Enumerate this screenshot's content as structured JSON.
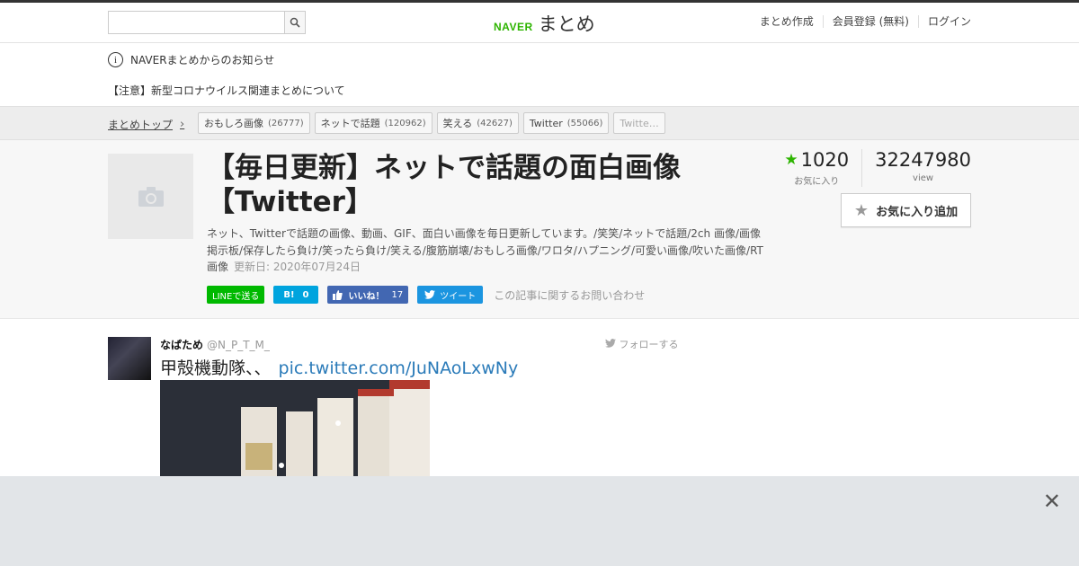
{
  "header": {
    "search_placeholder": "",
    "logo_naver": "NAVER",
    "logo_matome": "まとめ",
    "nav": [
      "まとめ作成",
      "会員登録 (無料)",
      "ログイン"
    ]
  },
  "notice": {
    "title": "NAVERまとめからのお知らせ",
    "link": "【注意】新型コロナウイルス関連まとめについて"
  },
  "breadcrumb": {
    "top": "まとめトップ",
    "tags": [
      {
        "label": "おもしろ画像",
        "count": "(26777)"
      },
      {
        "label": "ネットで話題",
        "count": "(120962)"
      },
      {
        "label": "笑える",
        "count": "(42627)"
      },
      {
        "label": "Twitter",
        "count": "(55066)"
      },
      {
        "label": "Twitte…",
        "count": ""
      }
    ]
  },
  "article": {
    "title_line1": "【毎日更新】ネットで話題の面白画像",
    "title_line2": "【Twitter】",
    "description": "ネット、Twitterで話題の画像、動画、GIF、面白い画像を毎日更新しています。/笑笑/ネットで話題/2ch 画像/画像掲示板/保存したら負け/笑ったら負け/笑える/腹筋崩壊/おもしろ画像/ワロタ/ハプニング/可愛い画像/吹いた画像/RT画像",
    "updated": "更新日: 2020年07月24日",
    "favorites_count": "1020",
    "favorites_label": "お気に入り",
    "views_count": "32247980",
    "views_label": "view",
    "fav_button": "お気に入り追加",
    "share": {
      "line": "LINEで送る",
      "hatena_icon": "B!",
      "hatena_count": "0",
      "fb_label": "いいね！",
      "fb_count": "17",
      "tw_label": "ツイート",
      "contact": "この記事に関するお問い合わせ"
    }
  },
  "tweet": {
    "name": "なぱため",
    "handle": "@N_P_T_M_",
    "follow": "フォローする",
    "text": "甲殻機動隊、、",
    "link": "pic.twitter.com/JuNAoLxwNy"
  },
  "colors": {
    "brand_green": "#2db400",
    "line_green": "#00b900",
    "hatena_blue": "#00a4de",
    "facebook_blue": "#4267b2",
    "twitter_blue": "#1b95e0"
  }
}
